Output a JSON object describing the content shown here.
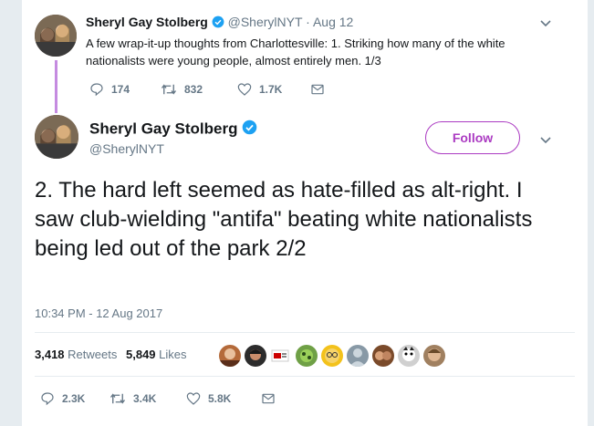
{
  "parent_tweet": {
    "author_name": "Sheryl Gay Stolberg",
    "handle": "@SherylNYT",
    "separator": "·",
    "date": "Aug 12",
    "text": "A few wrap-it-up thoughts from Charlottesville: 1. Striking how many of the white nationalists were young people, almost entirely men. 1/3",
    "replies": "174",
    "retweets": "832",
    "likes": "1.7K"
  },
  "main_tweet": {
    "author_name": "Sheryl Gay Stolberg",
    "handle": "@SherylNYT",
    "follow_label": "Follow",
    "text": "2. The hard left seemed as hate-filled as alt-right. I saw club-wielding \"antifa\" beating white nationalists being led out of the park 2/2",
    "timestamp": "10:34 PM - 12 Aug 2017",
    "retweet_count": "3,418",
    "retweet_label": "Retweets",
    "like_count": "5,849",
    "like_label": "Likes",
    "replies": "2.3K",
    "retweets": "3.4K",
    "likes": "5.8K"
  },
  "colors": {
    "accent_purple": "#ab3bc2",
    "thread_line": "#c58be0",
    "verified_blue": "#1da1f2",
    "muted": "#657786"
  },
  "icons": {
    "verified": "verified-badge-icon",
    "caret": "chevron-down-icon",
    "reply": "reply-icon",
    "retweet": "retweet-icon",
    "like": "heart-icon",
    "dm": "envelope-icon"
  },
  "likers_count_shown": 10
}
